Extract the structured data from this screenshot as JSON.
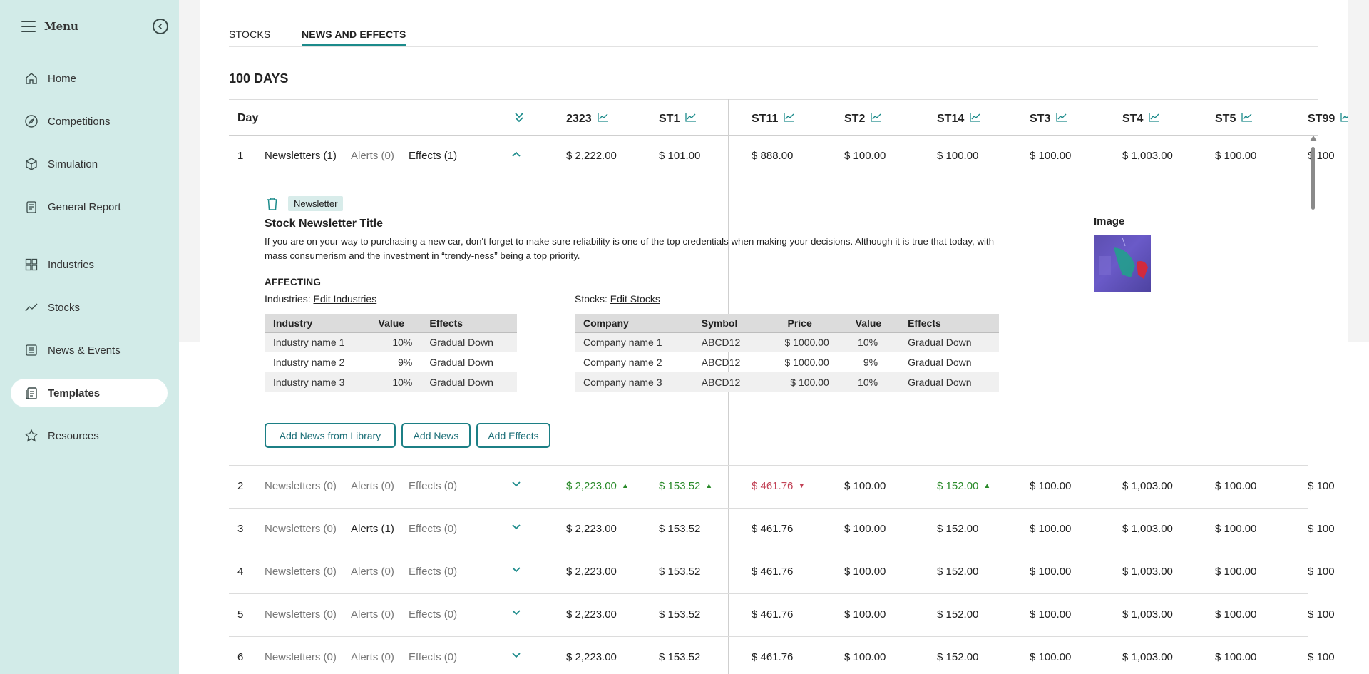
{
  "sidebar": {
    "menu_label": "Menu",
    "items": [
      {
        "label": "Home",
        "icon": "home-icon"
      },
      {
        "label": "Competitions",
        "icon": "compass-icon"
      },
      {
        "label": "Simulation",
        "icon": "cube-icon"
      },
      {
        "label": "General Report",
        "icon": "report-icon"
      },
      {
        "label": "Industries",
        "icon": "grid-icon"
      },
      {
        "label": "Stocks",
        "icon": "line-chart-icon"
      },
      {
        "label": "News & Events",
        "icon": "newspaper-icon"
      },
      {
        "label": "Templates",
        "icon": "templates-icon",
        "active": true
      },
      {
        "label": "Resources",
        "icon": "star-icon"
      }
    ]
  },
  "tabs": [
    {
      "label": "STOCKS"
    },
    {
      "label": "NEWS AND EFFECTS",
      "active": true
    }
  ],
  "days_title": "100 DAYS",
  "table": {
    "day_header": "Day",
    "stocks": [
      "2323",
      "ST1",
      "ST11",
      "ST2",
      "ST14",
      "ST3",
      "ST4",
      "ST5",
      "ST99"
    ],
    "rows": [
      {
        "day": "1",
        "newsletters": "Newsletters (1)",
        "alerts": "Alerts (0)",
        "effects": "Effects (1)",
        "values": [
          "$ 2,222.00",
          "$ 101.00",
          "$ 888.00",
          "$ 100.00",
          "$ 100.00",
          "$ 100.00",
          "$ 1,003.00",
          "$ 100.00",
          "$ 100"
        ]
      },
      {
        "day": "2",
        "newsletters": "Newsletters (0)",
        "alerts": "Alerts (0)",
        "effects": "Effects (0)",
        "values": [
          "$ 2,223.00",
          "$ 153.52",
          "$ 461.76",
          "$ 100.00",
          "$ 152.00",
          "$ 100.00",
          "$ 1,003.00",
          "$ 100.00",
          "$ 100"
        ],
        "trends": [
          "up",
          "up",
          "down",
          "",
          "up",
          "",
          "",
          "",
          ""
        ]
      },
      {
        "day": "3",
        "newsletters": "Newsletters (0)",
        "alerts": "Alerts (1)",
        "effects": "Effects (0)",
        "values": [
          "$ 2,223.00",
          "$ 153.52",
          "$ 461.76",
          "$ 100.00",
          "$ 152.00",
          "$ 100.00",
          "$ 1,003.00",
          "$ 100.00",
          "$ 100"
        ]
      },
      {
        "day": "4",
        "newsletters": "Newsletters (0)",
        "alerts": "Alerts (0)",
        "effects": "Effects (0)",
        "values": [
          "$ 2,223.00",
          "$ 153.52",
          "$ 461.76",
          "$ 100.00",
          "$ 152.00",
          "$ 100.00",
          "$ 1,003.00",
          "$ 100.00",
          "$ 100"
        ]
      },
      {
        "day": "5",
        "newsletters": "Newsletters (0)",
        "alerts": "Alerts (0)",
        "effects": "Effects (0)",
        "values": [
          "$ 2,223.00",
          "$ 153.52",
          "$ 461.76",
          "$ 100.00",
          "$ 152.00",
          "$ 100.00",
          "$ 1,003.00",
          "$ 100.00",
          "$ 100"
        ]
      },
      {
        "day": "6",
        "newsletters": "Newsletters (0)",
        "alerts": "Alerts (0)",
        "effects": "Effects (0)",
        "values": [
          "$ 2,223.00",
          "$ 153.52",
          "$ 461.76",
          "$ 100.00",
          "$ 152.00",
          "$ 100.00",
          "$ 1,003.00",
          "$ 100.00",
          "$ 100"
        ]
      }
    ]
  },
  "newsletter": {
    "badge": "Newsletter",
    "title": "Stock Newsletter Title",
    "body": "If you are on your way to purchasing a new car, don't forget to make sure reliability is one of the top credentials when making your decisions. Although it is true that today, with mass consumerism and the investment in “trendy-ness” being a top priority.",
    "affecting": "AFFECTING",
    "industries_label": "Industries:",
    "edit_industries": "Edit Industries",
    "stocks_label": "Stocks:",
    "edit_stocks": "Edit Stocks",
    "image_label": "Image",
    "industry_headers": [
      "Industry",
      "Value",
      "Effects"
    ],
    "industries": [
      [
        "Industry name 1",
        "10%",
        "Gradual Down"
      ],
      [
        "Industry name 2",
        "9%",
        "Gradual Down"
      ],
      [
        "Industry name 3",
        "10%",
        "Gradual Down"
      ]
    ],
    "stock_headers": [
      "Company",
      "Symbol",
      "Price",
      "Value",
      "Effects"
    ],
    "stocks": [
      [
        "Company name 1",
        "ABCD12",
        "$ 1000.00",
        "10%",
        "Gradual Down"
      ],
      [
        "Company name 2",
        "ABCD12",
        "$ 1000.00",
        "9%",
        "Gradual Down"
      ],
      [
        "Company name 3",
        "ABCD12",
        "$ 100.00",
        "10%",
        "Gradual Down"
      ]
    ],
    "buttons": [
      "Add News from Library",
      "Add News",
      "Add Effects"
    ]
  },
  "colors": {
    "accent": "#1c8b8b",
    "sidebar": "#d2ebe8",
    "up": "#2a8a2a",
    "down": "#c24155"
  }
}
